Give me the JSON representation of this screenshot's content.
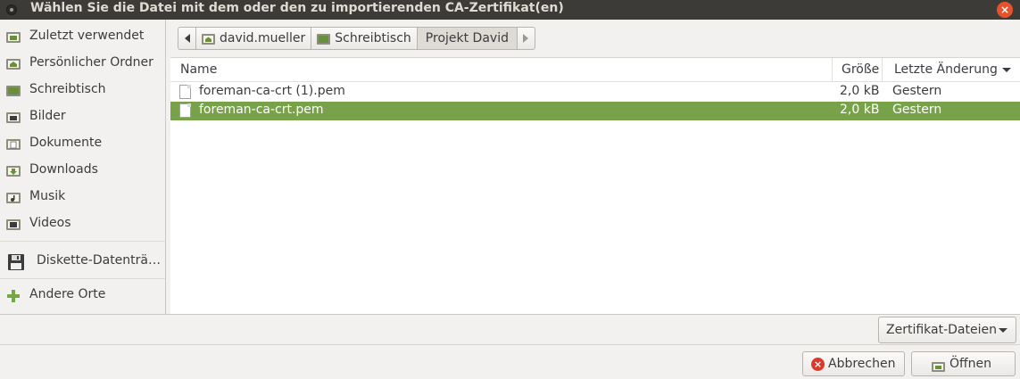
{
  "window": {
    "title": "Wählen Sie die Datei mit dem oder den zu importierenden CA-Zertifikat(en)",
    "close_glyph": "×"
  },
  "sidebar": {
    "items": [
      {
        "label": "Zuletzt verwendet",
        "icon": "recent-icon"
      },
      {
        "label": "Persönlicher Ordner",
        "icon": "home-folder-icon"
      },
      {
        "label": "Schreibtisch",
        "icon": "desktop-folder-icon"
      },
      {
        "label": "Bilder",
        "icon": "pictures-folder-icon"
      },
      {
        "label": "Dokumente",
        "icon": "documents-folder-icon"
      },
      {
        "label": "Downloads",
        "icon": "downloads-folder-icon"
      },
      {
        "label": "Musik",
        "icon": "music-folder-icon"
      },
      {
        "label": "Videos",
        "icon": "videos-folder-icon"
      }
    ],
    "device": {
      "label": "Diskette-Datenträ…",
      "icon": "floppy-disk-icon"
    },
    "other": {
      "label": "Andere Orte",
      "icon": "plus-icon"
    }
  },
  "pathbar": {
    "segments": [
      {
        "label": "david.mueller",
        "icon": "home-folder-icon"
      },
      {
        "label": "Schreibtisch",
        "icon": "desktop-folder-icon"
      },
      {
        "label": "Projekt David",
        "active": true
      }
    ]
  },
  "filelist": {
    "columns": {
      "name": "Name",
      "size": "Größe",
      "modified": "Letzte Änderung"
    },
    "rows": [
      {
        "name": "foreman-ca-crt (1).pem",
        "size": "2,0 kB",
        "modified": "Gestern",
        "selected": false
      },
      {
        "name": "foreman-ca-crt.pem",
        "size": "2,0 kB",
        "modified": "Gestern",
        "selected": true
      }
    ]
  },
  "filter": {
    "selected": "Zertifikat-Dateien"
  },
  "actions": {
    "cancel": "Abbrechen",
    "open": "Öffnen"
  },
  "colors": {
    "accent": "#77a24a",
    "titlebar": "#3c3b37",
    "close": "#e8522a"
  }
}
